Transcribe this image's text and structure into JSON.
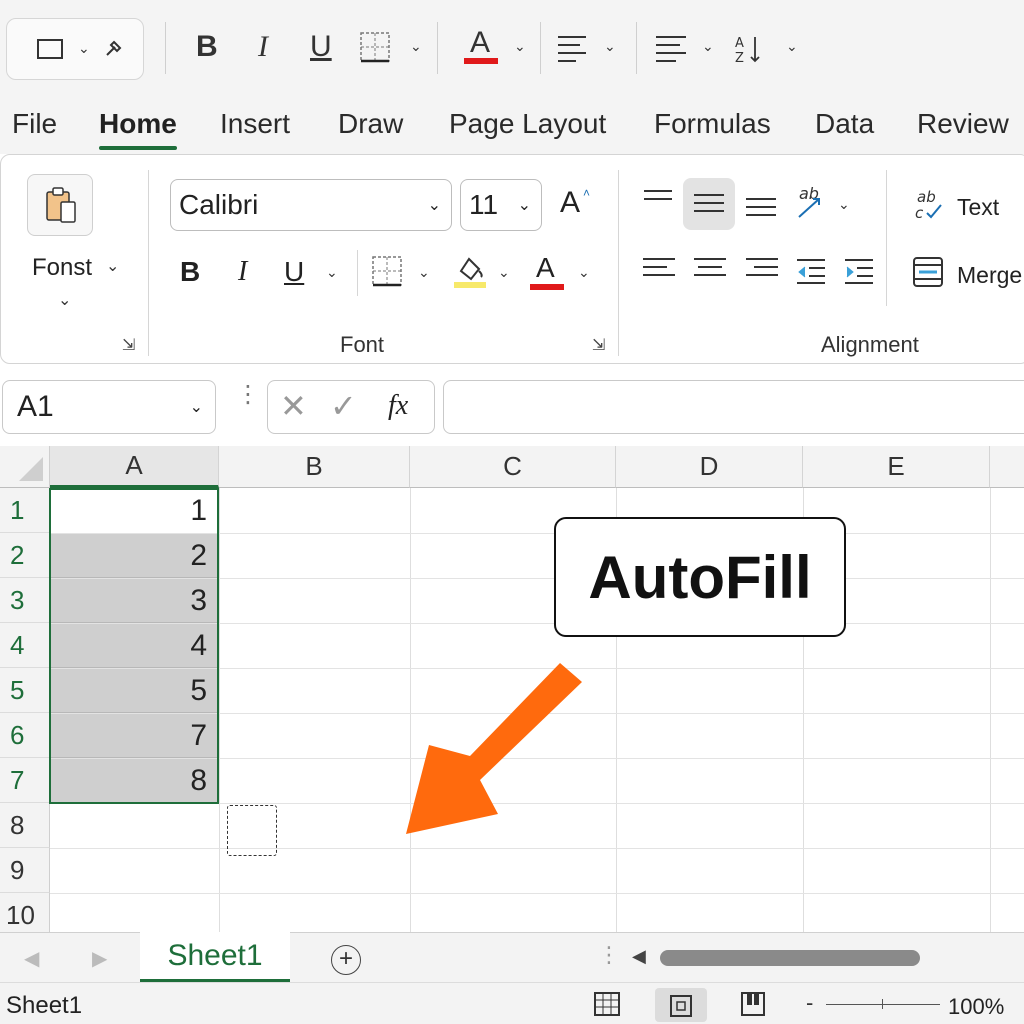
{
  "quick_access": {
    "icons": [
      "window-icon",
      "brush-icon",
      "bold-icon",
      "italic-icon",
      "underline-icon",
      "borders-icon",
      "font-color-icon",
      "align-left-icon",
      "align-justify-icon",
      "text-direction-icon"
    ],
    "bold": "B",
    "italic": "I",
    "underline": "U",
    "font_color": "A"
  },
  "menu": {
    "tabs": [
      {
        "label": "File"
      },
      {
        "label": "Home"
      },
      {
        "label": "Insert"
      },
      {
        "label": "Draw"
      },
      {
        "label": "Page Layout"
      },
      {
        "label": "Formulas"
      },
      {
        "label": "Data"
      },
      {
        "label": "Review"
      }
    ],
    "active": "Home"
  },
  "ribbon": {
    "clipboard": {
      "paste_label": "Fonst"
    },
    "font": {
      "group_label": "Font",
      "font_name": "Calibri",
      "font_size": "11",
      "grow_font": "A",
      "bold": "B",
      "italic": "I",
      "underline": "U",
      "font_color": "A",
      "highlight_color": "#f7e96a",
      "font_color_value": "#e0191a"
    },
    "alignment": {
      "group_label": "Alignment",
      "wrap_text_label": "Text",
      "merge_label": "Merge",
      "orientation_glyph": "ab"
    }
  },
  "formula_bar": {
    "name_box": "A1",
    "fx": "fx",
    "formula": ""
  },
  "grid": {
    "columns": [
      "A",
      "B",
      "C",
      "D",
      "E"
    ],
    "rows": [
      "1",
      "2",
      "3",
      "4",
      "5",
      "6",
      "7",
      "8",
      "9",
      "10"
    ],
    "column_a_values": [
      "1",
      "2",
      "3",
      "4",
      "5",
      "7",
      "8"
    ],
    "selected_range": "A1:A7",
    "accent_color": "#1e6e3a"
  },
  "callout": {
    "text": "AutoFill",
    "arrow_color": "#ff6a0d"
  },
  "sheets": {
    "tabs": [
      "Sheet1"
    ],
    "active": "Sheet1"
  },
  "status": {
    "sheet_name": "Sheet1",
    "zoom": "100%"
  }
}
